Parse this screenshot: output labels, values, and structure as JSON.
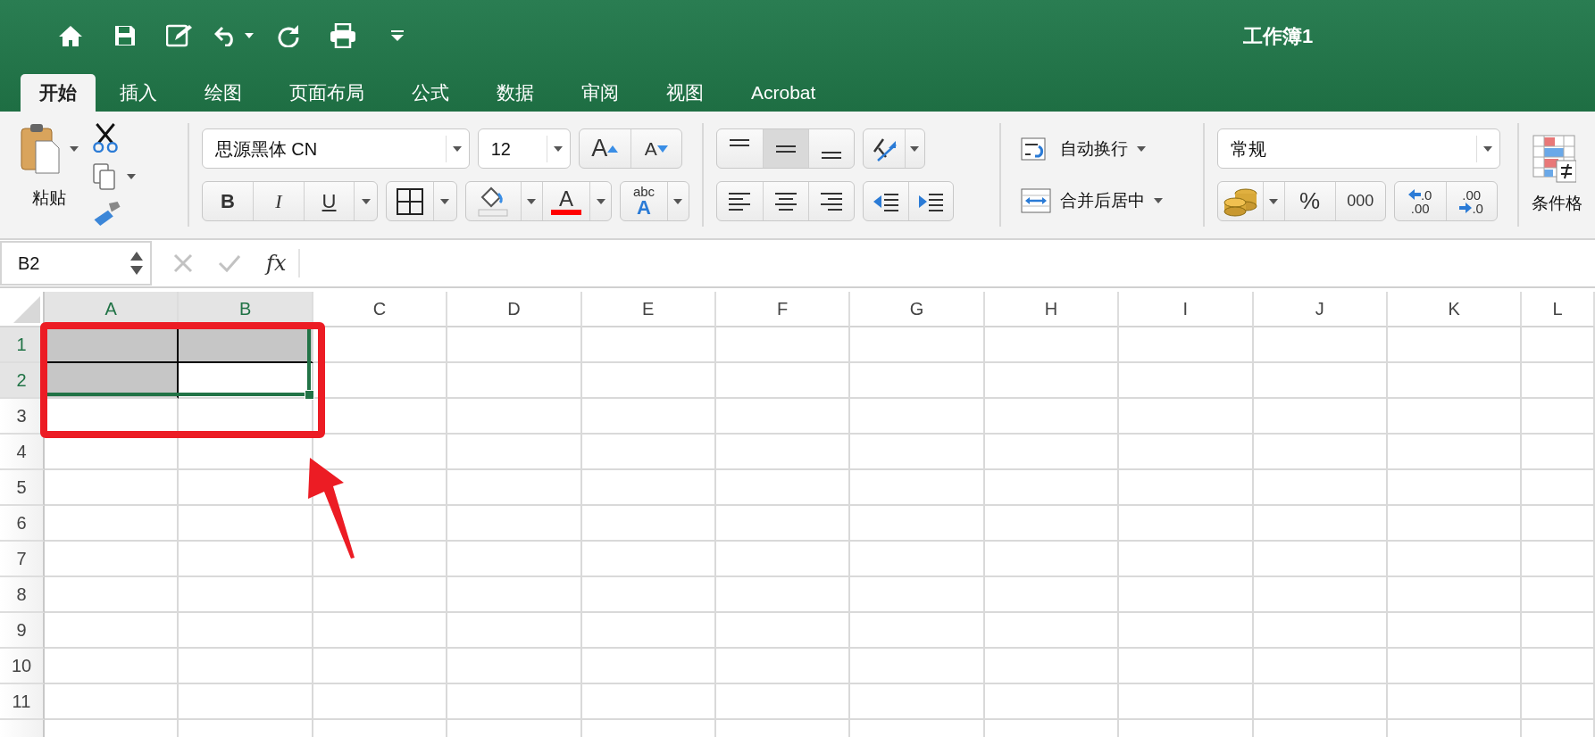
{
  "window": {
    "title": "工作簿1"
  },
  "tabs": [
    {
      "label": "开始",
      "selected": true
    },
    {
      "label": "插入",
      "selected": false
    },
    {
      "label": "绘图",
      "selected": false
    },
    {
      "label": "页面布局",
      "selected": false
    },
    {
      "label": "公式",
      "selected": false
    },
    {
      "label": "数据",
      "selected": false
    },
    {
      "label": "审阅",
      "selected": false
    },
    {
      "label": "视图",
      "selected": false
    },
    {
      "label": "Acrobat",
      "selected": false
    }
  ],
  "ribbon": {
    "paste_label": "粘贴",
    "font_name": "思源黑体 CN",
    "font_size": "12",
    "grow_font": "A",
    "shrink_font": "A",
    "bold": "B",
    "italic": "I",
    "underline": "U",
    "font_color": "A",
    "phonetic": [
      "abc",
      "A"
    ],
    "vertical_align": [
      {
        "kind": "top",
        "selected": false
      },
      {
        "kind": "middle",
        "selected": true
      },
      {
        "kind": "bottom",
        "selected": false
      }
    ],
    "wrap_text": "自动换行",
    "merge_center": "合并后居中",
    "number_format": "常规",
    "percent": "%",
    "comma": "000",
    "decimals": [
      {
        "kind": "increase",
        "top": ".0",
        "bottom": ".00"
      },
      {
        "kind": "decrease",
        "top": ".00",
        "bottom": ".0"
      }
    ],
    "conditional_format": "条件格"
  },
  "formula_bar": {
    "name_box": "B2",
    "fx": "fx"
  },
  "sheet": {
    "columns": [
      {
        "label": "A",
        "selected": true
      },
      {
        "label": "B",
        "selected": true
      },
      {
        "label": "C",
        "selected": false
      },
      {
        "label": "D",
        "selected": false
      },
      {
        "label": "E",
        "selected": false
      },
      {
        "label": "F",
        "selected": false
      },
      {
        "label": "G",
        "selected": false
      },
      {
        "label": "H",
        "selected": false
      },
      {
        "label": "I",
        "selected": false
      },
      {
        "label": "J",
        "selected": false
      },
      {
        "label": "K",
        "selected": false
      },
      {
        "label": "L",
        "selected": false
      }
    ],
    "rows": [
      {
        "label": "1",
        "selected": true,
        "cells": [
          {
            "shaded": true,
            "border_right": true,
            "border_bottom": true
          },
          {
            "shaded": true,
            "border_right": false,
            "border_bottom": true
          }
        ]
      },
      {
        "label": "2",
        "selected": true,
        "cells": [
          {
            "shaded": true,
            "border_right": true
          },
          {
            "shaded": false
          }
        ]
      },
      {
        "label": "3",
        "selected": false
      },
      {
        "label": "4",
        "selected": false
      },
      {
        "label": "5",
        "selected": false
      },
      {
        "label": "6",
        "selected": false
      },
      {
        "label": "7",
        "selected": false
      },
      {
        "label": "8",
        "selected": false
      },
      {
        "label": "9",
        "selected": false
      },
      {
        "label": "10",
        "selected": false
      },
      {
        "label": "11",
        "selected": false
      }
    ]
  }
}
